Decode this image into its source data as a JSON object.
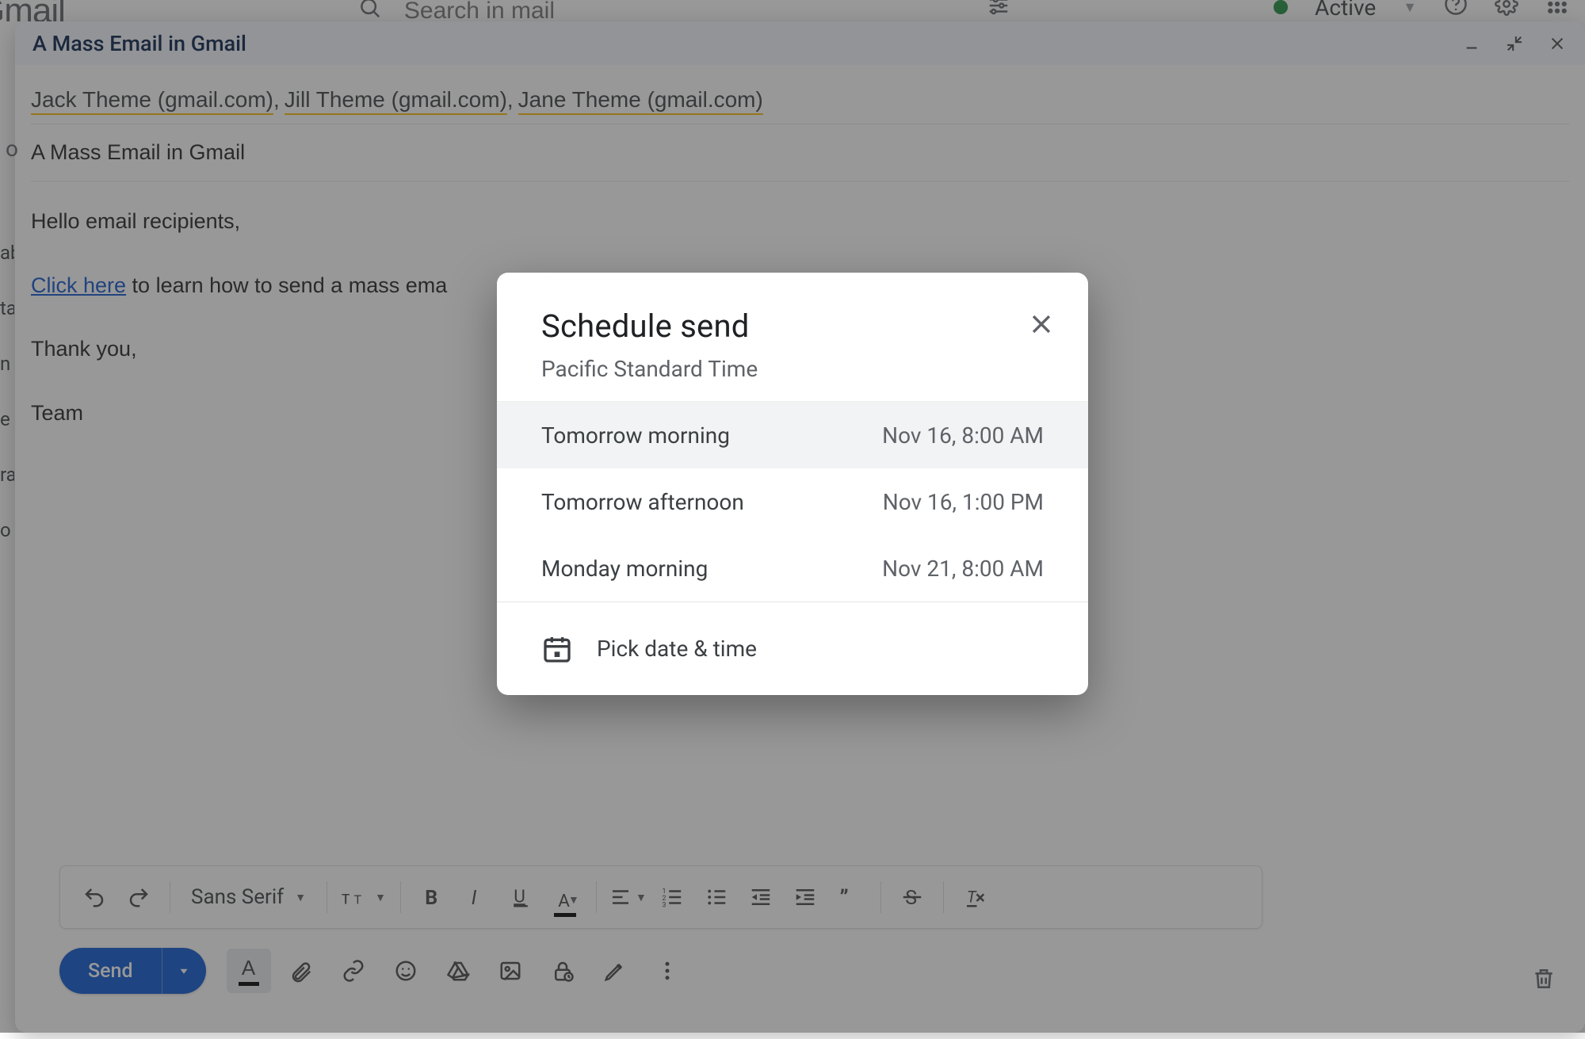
{
  "topbar": {
    "logo_text": "Gmail",
    "search_placeholder": "Search in mail",
    "status_label": "Active"
  },
  "compose": {
    "title": "A Mass Email in Gmail",
    "to_prefix": "o",
    "recipients": [
      "Jack Theme (gmail.com)",
      "Jill Theme (gmail.com)",
      "Jane Theme (gmail.com)"
    ],
    "subject": "A Mass Email in Gmail",
    "body_greeting": "Hello email recipients,",
    "body_link_text": "Click here",
    "body_after_link": " to learn how to send a mass ema",
    "body_thanks": "Thank you,",
    "body_sign": "Team"
  },
  "format_toolbar": {
    "font_label": "Sans Serif"
  },
  "send": {
    "label": "Send"
  },
  "modal": {
    "title": "Schedule send",
    "subtitle": "Pacific Standard Time",
    "options": [
      {
        "label": "Tomorrow morning",
        "when": "Nov 16, 8:00 AM",
        "hover": true
      },
      {
        "label": "Tomorrow afternoon",
        "when": "Nov 16, 1:00 PM",
        "hover": false
      },
      {
        "label": "Monday morning",
        "when": "Nov 21, 8:00 AM",
        "hover": false
      }
    ],
    "pick_label": "Pick date & time"
  },
  "sidebar_slivers": [
    "ab",
    "ta",
    "n",
    "e",
    "ra",
    "o"
  ]
}
